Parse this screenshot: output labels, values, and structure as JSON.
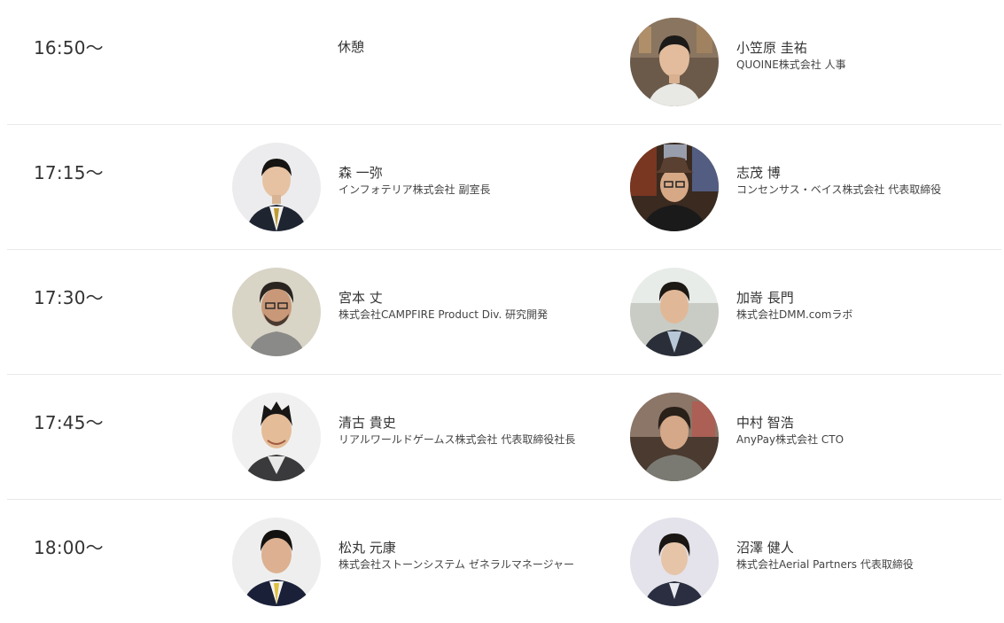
{
  "schedule": {
    "rows": [
      {
        "time": "16:50〜",
        "rest": "休憩",
        "right": {
          "name": "小笠原 圭祐",
          "company": "QUOINE株式会社 人事"
        }
      },
      {
        "time": "17:15〜",
        "left": {
          "name": "森 一弥",
          "company": "インフォテリア株式会社 副室長"
        },
        "right": {
          "name": "志茂 博",
          "company": "コンセンサス・ベイス株式会社 代表取締役"
        }
      },
      {
        "time": "17:30〜",
        "left": {
          "name": "宮本 丈",
          "company": "株式会社CAMPFIRE Product Div. 研究開発"
        },
        "right": {
          "name": "加嵜 長門",
          "company": "株式会社DMM.comラボ"
        }
      },
      {
        "time": "17:45〜",
        "left": {
          "name": "清古 貴史",
          "company": "リアルワールドゲームス株式会社 代表取締役社長"
        },
        "right": {
          "name": "中村 智浩",
          "company": "AnyPay株式会社 CTO"
        }
      },
      {
        "time": "18:00〜",
        "left": {
          "name": "松丸 元康",
          "company": "株式会社ストーンシステム ゼネラルマネージャー"
        },
        "right": {
          "name": "沼澤 健人",
          "company": "株式会社Aerial Partners 代表取締役"
        }
      }
    ]
  },
  "colors": {
    "divider": "#e8e8e8",
    "text": "#333333"
  }
}
